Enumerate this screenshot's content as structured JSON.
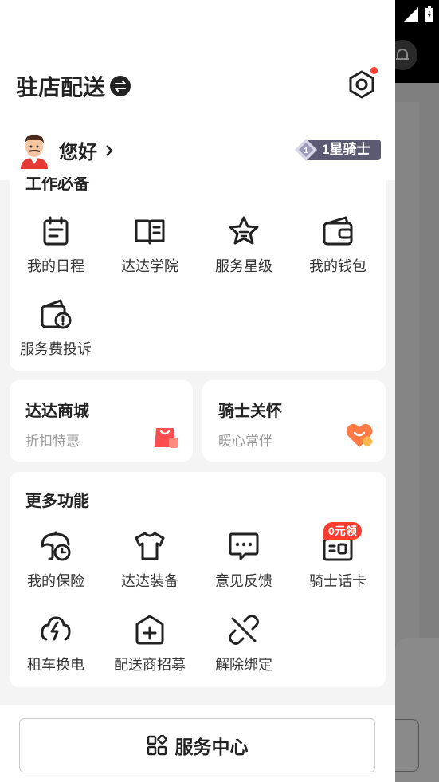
{
  "header": {
    "title": "驻店配送"
  },
  "user": {
    "greeting": "您好",
    "rank": "1星骑士"
  },
  "tools_section": {
    "title": "工作必备",
    "items": [
      {
        "label": "我的日程",
        "icon": "calendar-icon"
      },
      {
        "label": "达达学院",
        "icon": "book-icon"
      },
      {
        "label": "服务星级",
        "icon": "star-icon"
      },
      {
        "label": "我的钱包",
        "icon": "wallet-icon"
      },
      {
        "label": "服务费投诉",
        "icon": "complaint-wallet-icon"
      }
    ]
  },
  "mall": {
    "title": "达达商城",
    "subtitle": "折扣特惠",
    "icon": "shopping-bag-icon"
  },
  "care": {
    "title": "骑士关怀",
    "subtitle": "暖心常伴",
    "icon": "heart-icon"
  },
  "more_section": {
    "title": "更多功能",
    "promo_badge": "0元领",
    "items": [
      {
        "label": "我的保险",
        "icon": "umbrella-clock-icon"
      },
      {
        "label": "达达装备",
        "icon": "shirt-icon"
      },
      {
        "label": "意见反馈",
        "icon": "feedback-icon"
      },
      {
        "label": "骑士话卡",
        "icon": "sim-card-icon"
      },
      {
        "label": "租车换电",
        "icon": "battery-swap-icon"
      },
      {
        "label": "配送商招募",
        "icon": "add-hexagon-icon"
      },
      {
        "label": "解除绑定",
        "icon": "unlink-icon"
      }
    ]
  },
  "footer": {
    "service_label": "服务中心"
  },
  "colors": {
    "accent_red": "#ff3b30",
    "text_dark": "#222222",
    "text_muted": "#999999",
    "rank_bg": "#5a5a72"
  }
}
